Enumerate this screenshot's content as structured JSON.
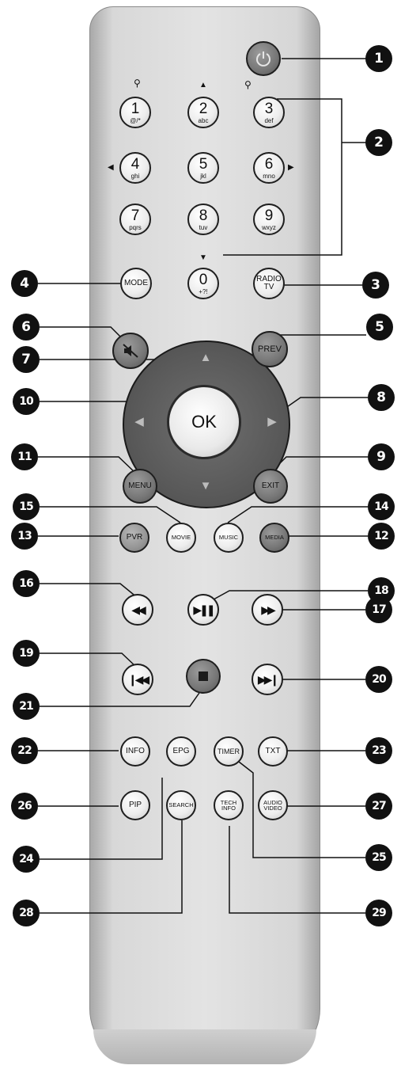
{
  "remote": {
    "power_icon": "power-icon",
    "numbers": [
      {
        "digit": "1",
        "sub": "@/*"
      },
      {
        "digit": "2",
        "sub": "abc"
      },
      {
        "digit": "3",
        "sub": "def"
      },
      {
        "digit": "4",
        "sub": "ghi"
      },
      {
        "digit": "5",
        "sub": "jkl"
      },
      {
        "digit": "6",
        "sub": "mno"
      },
      {
        "digit": "7",
        "sub": "pqrs"
      },
      {
        "digit": "8",
        "sub": "tuv"
      },
      {
        "digit": "9",
        "sub": "wxyz"
      },
      {
        "digit": "0",
        "sub": "+?!"
      }
    ],
    "mode": "MODE",
    "radio_tv": [
      "RADIO",
      "TV"
    ],
    "mute_icon": "mute-icon",
    "prev": "PREV",
    "ok": "OK",
    "menu": "MENU",
    "exit": "EXIT",
    "pvr": "PVR",
    "movie": "MOVIE",
    "music": "MUSIC",
    "media": "MEDIA",
    "rewind": "◀◀",
    "play_pause": "▶❚❚",
    "fast_forward": "▶▶",
    "skip_back": "❙◀◀",
    "skip_forward": "▶▶❙",
    "info": "INFO",
    "epg": "EPG",
    "timer": "TIMER",
    "txt": "TXT",
    "pip": "PIP",
    "search": "SEARCH",
    "tech_info": [
      "TECH",
      "INFO"
    ],
    "audio_video": [
      "AUDIO",
      "VIDEO"
    ]
  },
  "callouts": [
    "1",
    "2",
    "3",
    "4",
    "5",
    "6",
    "7",
    "8",
    "9",
    "10",
    "11",
    "12",
    "13",
    "14",
    "15",
    "16",
    "17",
    "18",
    "19",
    "20",
    "21",
    "22",
    "23",
    "24",
    "25",
    "26",
    "27",
    "28",
    "29"
  ]
}
